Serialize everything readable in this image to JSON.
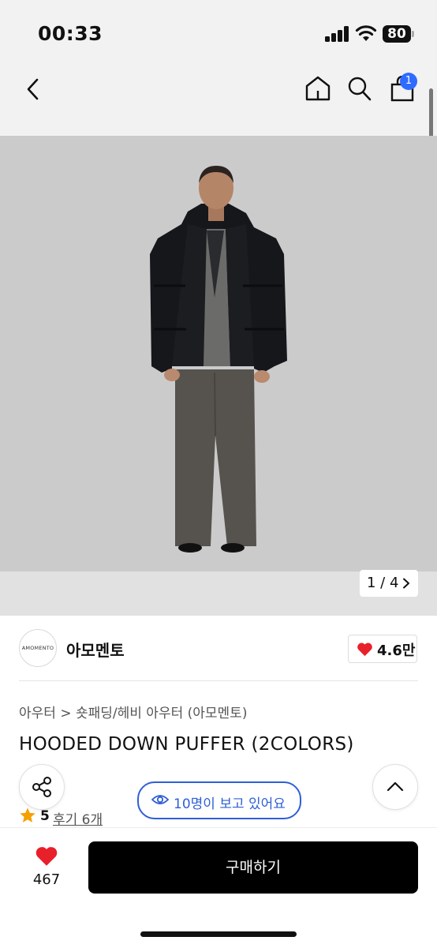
{
  "status_bar": {
    "time": "00:33",
    "battery": "80"
  },
  "header": {
    "cart_badge": "1"
  },
  "gallery": {
    "pager": "1 / 4"
  },
  "brand": {
    "logo_text": "AMOMENTO",
    "name": "아모멘토",
    "likes": "4.6만"
  },
  "product": {
    "breadcrumb": "아우터 > 숏패딩/헤비 아우터 (아모멘토)",
    "title": "HOODED DOWN PUFFER (2COLORS)",
    "rating": "5",
    "reviews": "후기 6개",
    "viewers": "10명이 보고 있어요"
  },
  "bottom_bar": {
    "like_count": "467",
    "buy_label": "구매하기"
  },
  "colors": {
    "accent_blue": "#2f5fd6",
    "badge_blue": "#2f6bff",
    "heart_red": "#e8202a",
    "star_orange": "#f5a000"
  }
}
